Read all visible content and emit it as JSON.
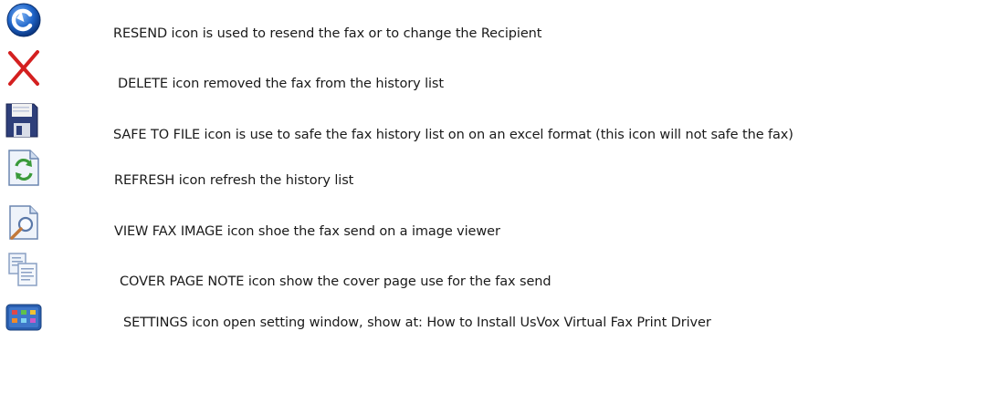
{
  "icons": [
    {
      "name": "resend-icon",
      "description": "RESEND icon is used to resend the fax or to change the Recipient"
    },
    {
      "name": "delete-icon",
      "description": "DELETE icon removed the fax from the history list"
    },
    {
      "name": "save-icon",
      "description": "SAFE TO FILE icon is use to safe the fax history list on on an excel format (this icon will not safe the fax)"
    },
    {
      "name": "refresh-icon",
      "description": "REFRESH icon refresh the history list"
    },
    {
      "name": "view-image-icon",
      "description": "VIEW FAX IMAGE icon shoe the fax send on a image viewer"
    },
    {
      "name": "cover-page-icon",
      "description": "COVER PAGE NOTE icon show the cover page use for the fax send"
    },
    {
      "name": "settings-icon",
      "description": "SETTINGS icon open setting window, show at: How to Install UsVox Virtual Fax Print Driver"
    }
  ],
  "colors": {
    "resend_blue": "#1e64c8",
    "delete_red": "#d42020",
    "save_navy": "#2e3f7a",
    "refresh_green": "#3a9a3a",
    "settings_blue": "#2a5fb0"
  }
}
